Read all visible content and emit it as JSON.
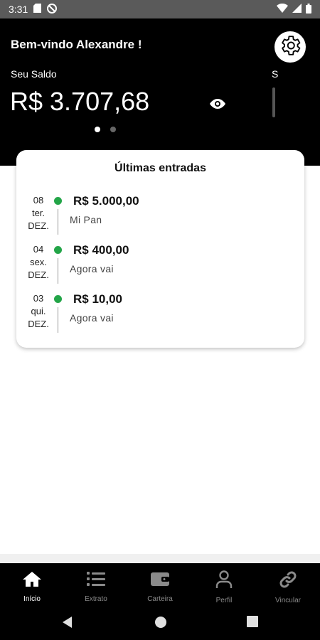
{
  "status_bar": {
    "time": "3:31"
  },
  "header": {
    "welcome": "Bem-vindo Alexandre !",
    "balance_label": "Seu Saldo",
    "balance_value": "R$ 3.707,68",
    "next_card_label": "S"
  },
  "entries_card": {
    "title": "Últimas entradas",
    "entries": [
      {
        "day": "08",
        "weekday": "ter.",
        "month": "DEZ.",
        "amount": "R$ 5.000,00",
        "description": "Mi Pan"
      },
      {
        "day": "04",
        "weekday": "sex.",
        "month": "DEZ.",
        "amount": "R$ 400,00",
        "description": "Agora vai"
      },
      {
        "day": "03",
        "weekday": "qui.",
        "month": "DEZ.",
        "amount": "R$ 10,00",
        "description": "Agora vai"
      }
    ]
  },
  "bottom_nav": {
    "items": [
      {
        "label": "Início",
        "icon": "home-icon"
      },
      {
        "label": "Extrato",
        "icon": "list-icon"
      },
      {
        "label": "Carteira",
        "icon": "wallet-icon"
      },
      {
        "label": "Perfil",
        "icon": "person-icon"
      },
      {
        "label": "Vincular",
        "icon": "link-icon"
      }
    ]
  },
  "colors": {
    "header_bg": "#000000",
    "accent_green": "#23a548",
    "inactive_nav": "#8a8a8a"
  }
}
